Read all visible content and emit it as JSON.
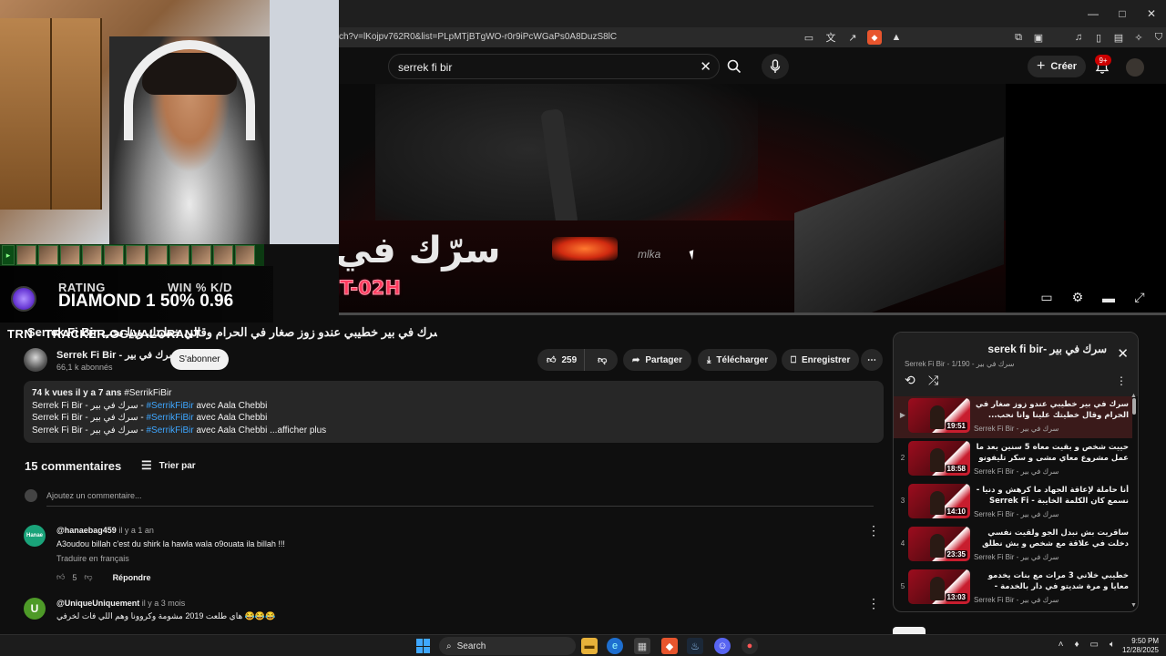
{
  "browser": {
    "url": "ch?v=lKojpv762R0&list=PLpMTjBTgWO-r0r9iPcWGaPs0A8DuzS8lC",
    "window_controls": [
      "—",
      "□",
      "✕"
    ]
  },
  "header": {
    "search_query": "serrek fi bir",
    "create_label": "Créer",
    "notifications_badge": "9+"
  },
  "video_overlay": {
    "arabic_logo": "سرّك في",
    "show_banner": "MINUIT-02H",
    "brand": "mlka"
  },
  "stream_overlay": {
    "rating_label": "RATING",
    "winpct_label": "WIN % K/D",
    "rank_value": "DIAMOND 1  50% 0.96",
    "tracker_text": "TRN - TRACKER.GG/VALORANT"
  },
  "video": {
    "title": "Serrek Fi Bir سرك في بير خطيبي عندو زوز صغار في الحرام وقالي خطيتك وبيا نحب",
    "channel_name": "Serrek Fi Bir - سرك في بير",
    "subscribers": "66,1 k abonnés",
    "subscribe_label": "S'abonner",
    "likes": "259",
    "share_label": "Partager",
    "download_label": "Télécharger",
    "save_label": "Enregistrer",
    "description": {
      "views": "74 k vues",
      "age": "il y a 7 ans",
      "meta_hashtag": "#SerrikFiBir",
      "line1_prefix": "Serrek Fi Bir - سرك في بير - ",
      "line1_hashtag": "#SerrikFiBir",
      "line1_suffix": " avec Aala Chebbi",
      "line2_prefix": "Serrek Fi Bir - سرك في بير - ",
      "line2_hashtag": "#SerrikFiBir",
      "line2_suffix": " avec Aala Chebbi",
      "line3_prefix": "Serrek Fi Bir - سرك في بير - ",
      "line3_hashtag": "#SerrikFiBir",
      "line3_suffix": " avec Aala Chebbi ...afficher plus"
    }
  },
  "comments": {
    "count_label": "15 commentaires",
    "sort_label": "Trier par",
    "add_placeholder": "Ajoutez un commentaire...",
    "items": [
      {
        "author": "@hanaebag459",
        "time": "il y a 1 an",
        "avatar_text": "Hanae",
        "text": "A3oudou billah c'est du shirk la hawla wala o9ouata ila billah !!!",
        "translate": "Traduire en français",
        "likes": "5",
        "reply": "Répondre"
      },
      {
        "author": "@UniqueUniquement",
        "time": "il y a 3 mois",
        "avatar_text": "U",
        "text": "هاي طلعت 2019 مشومة وكروونا وهم اللي فات لخرفي 😂😂😂"
      }
    ]
  },
  "playlist": {
    "title": "serek fi bir- سرك في بير",
    "subtitle": "Serrek Fi Bir - سرك في بير - 1/190",
    "items": [
      {
        "index": "▶",
        "duration": "19:51",
        "title": "سرك في بير خطيبي عندو زوز صغار في الحرام وقال خطيتك علينا وانا نحب...",
        "channel": "Serrek Fi Bir - سرك في بير"
      },
      {
        "index": "2",
        "duration": "18:58",
        "title": "حييت شخص و بقيت معاه 5 سنين بعد ما عمل مشروع معاي مشى و سكر تليفونو ...",
        "channel": "Serrek Fi Bir - سرك في بير"
      },
      {
        "index": "3",
        "duration": "14:10",
        "title": "أنا حاملة لإعاقة الجهاد ما كرهش و دنيا - نسمع كان الكلمة الخايبة - Serrek Fi Bi...",
        "channel": "Serrek Fi Bir - سرك في بير"
      },
      {
        "index": "4",
        "duration": "23:35",
        "title": "ساقريت بش نبدل الجو ولقيت نفسي دخلت في علاقة مع شخص و بش نطلق عندي 3 صغار - ...",
        "channel": "Serrek Fi Bir - سرك في بير"
      },
      {
        "index": "5",
        "duration": "13:03",
        "title": "خطيبي خلاني 3 مرات مع بنات يخدمو معايا و مرة شديتو في دار بالخدمة - Serrek Fi...",
        "channel": "Serrek Fi Bir - سرك في بير"
      }
    ]
  },
  "taskbar": {
    "search_label": "Search",
    "time": "9:50 PM",
    "date": "12/28/2025"
  }
}
